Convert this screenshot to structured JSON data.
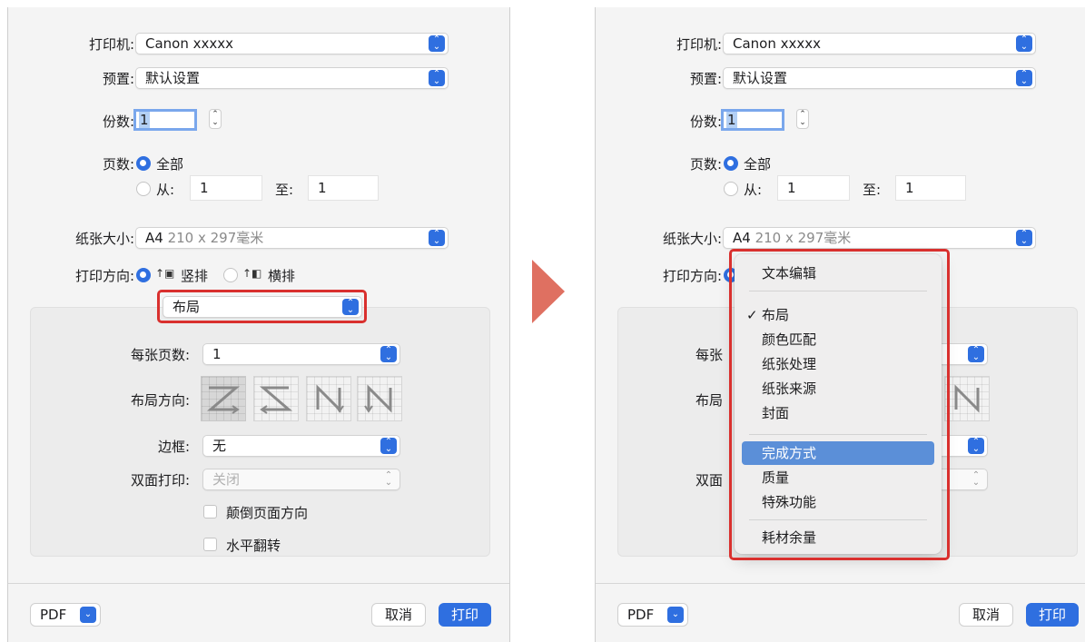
{
  "dialog": {
    "printer_label": "打印机:",
    "printer_value": "Canon xxxxx",
    "preset_label": "预置:",
    "preset_value": "默认设置",
    "copies_label": "份数:",
    "copies_value": "1",
    "pages_label": "页数:",
    "pages_all": "全部",
    "pages_from": "从:",
    "pages_from_value": "1",
    "pages_to": "至:",
    "pages_to_value": "1",
    "paper_size_label": "纸张大小:",
    "paper_size_value": "A4",
    "paper_size_detail": "210 x 297毫米",
    "orientation_label": "打印方向:",
    "orientation_portrait": "竖排",
    "orientation_landscape": "横排",
    "section_select_value": "布局",
    "pages_per_sheet_label": "每张页数:",
    "pages_per_sheet_value": "1",
    "layout_direction_label": "布局方向:",
    "border_label": "边框:",
    "border_value": "无",
    "duplex_label": "双面打印:",
    "duplex_value": "关闭",
    "reverse_orientation": "颠倒页面方向",
    "flip_horizontal": "水平翻转",
    "pdf_button": "PDF",
    "cancel_button": "取消",
    "print_button": "打印"
  },
  "right_dialog": {
    "pages_per_sheet_partial": "每张",
    "layout_direction_partial": "布局",
    "duplex_partial": "双面"
  },
  "menu": {
    "items": [
      "文本编辑",
      "布局",
      "颜色匹配",
      "纸张处理",
      "纸张来源",
      "封面",
      "完成方式",
      "质量",
      "特殊功能",
      "耗材余量"
    ],
    "checked_item": "布局",
    "highlighted_item": "完成方式",
    "check_mark": "✓"
  },
  "colors": {
    "accent": "#2f6fe0",
    "highlight_box": "#d9302e",
    "arrow": "#df7061",
    "menu_highlight": "#5b8fd8"
  }
}
